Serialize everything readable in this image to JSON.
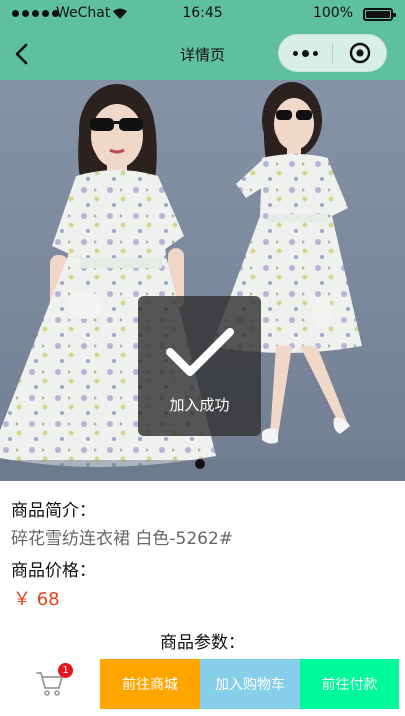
{
  "status_bar": {
    "carrier": "WeChat",
    "time": "16:45",
    "battery": "100%"
  },
  "nav": {
    "title": "详情页"
  },
  "toast": {
    "text": "加入成功"
  },
  "product": {
    "intro_label": "商品简介：",
    "intro_text": "碎花雪纺连衣裙 白色-5262#",
    "price_label": "商品价格：",
    "price": "￥ 68",
    "params_label": "商品参数："
  },
  "swiper": {
    "count": 1,
    "active": 0
  },
  "bottom_bar": {
    "cart_badge": "1",
    "goto_mall": "前往商城",
    "add_to_cart": "加入购物车",
    "goto_pay": "前往付款"
  },
  "colors": {
    "nav_bg": "#5fc0a0",
    "price": "#e8421a",
    "mall_btn": "#ffa500",
    "cart_btn": "#87ceeb",
    "pay_btn": "#00fa9a",
    "badge": "#e6141e"
  },
  "icons": [
    "signal-dots-icon",
    "wifi-icon",
    "battery-icon",
    "back-arrow-icon",
    "more-dots-icon",
    "record-target-icon",
    "checkmark-icon",
    "shopping-cart-icon"
  ]
}
